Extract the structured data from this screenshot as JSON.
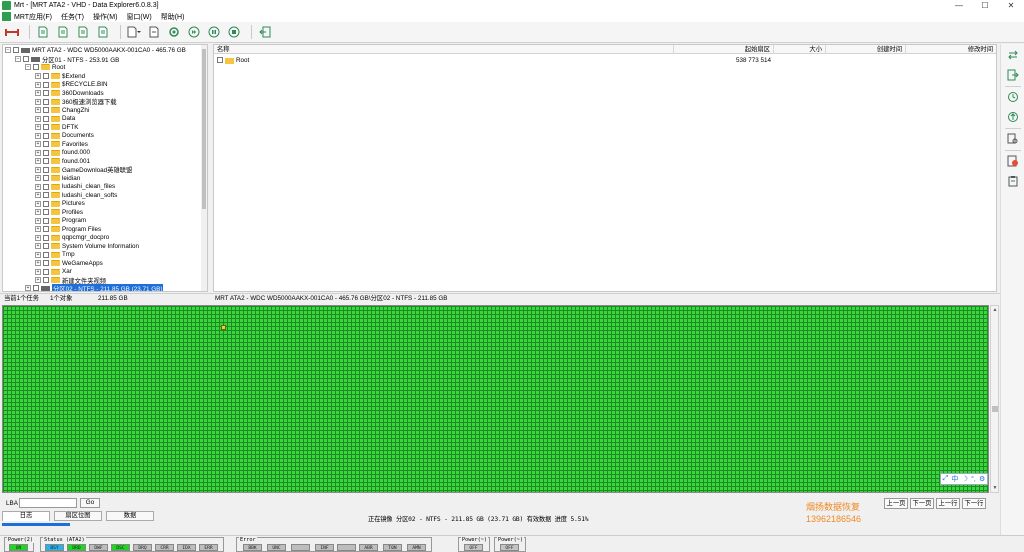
{
  "window": {
    "title": "Mrt - [MRT ATA2 - VHD - Data Explorer6.0.8.3]",
    "minimize": "—",
    "maximize": "☐",
    "close": "✕"
  },
  "menu": {
    "items": [
      "MRT应用(F)",
      "任务(T)",
      "操作(M)",
      "窗口(W)",
      "帮助(H)"
    ]
  },
  "tree": {
    "disk": "MRT ATA2 - WDC WD5000AAKX-001CA0 - 465.76 GB",
    "partition1": "分区01 - NTFS - 253.91 GB",
    "root": "Root",
    "folders": [
      "$Extend",
      "$RECYCLE.BIN",
      "360Downloads",
      "360极速浏览器下载",
      "ChangZhi",
      "Data",
      "DFTK",
      "Documents",
      "Favorites",
      "found.000",
      "found.001",
      "GameDownload英雄联盟",
      "leidian",
      "ludashi_clean_files",
      "ludashi_clean_softs",
      "Pictures",
      "Profiles",
      "Program",
      "Program Files",
      "qqpcmgr_docpro",
      "System Volume Information",
      "Tmp",
      "WeGameApps",
      "Xar",
      "新建文件夹视频"
    ],
    "partition2": "分区02 - NTFS - 211.85 GB (23.71 GB)"
  },
  "filelist": {
    "columns": [
      "名称",
      "起始扇区",
      "大小",
      "创建时间",
      "修改时间"
    ],
    "rows": [
      {
        "name": "Root",
        "start_sector": "538 773 514",
        "size": "",
        "created": "",
        "modified": ""
      }
    ]
  },
  "status": {
    "tasks": "当前1个任务",
    "objects": "1个对象",
    "size": "211.85 GB",
    "path": "MRT ATA2 - WDC WD5000AAKX-001CA0 - 465.76 GB\\分区02 - NTFS - 211.85 GB"
  },
  "ime": {
    "items": [
      "中",
      "☽",
      "°,",
      "⚙"
    ]
  },
  "bottom": {
    "lba_label": "LBA",
    "lba_value": "",
    "go_label": "Go",
    "tabs": [
      "日志",
      "扇区位图",
      "数据"
    ],
    "task_text": "正在镜像 分区02 - NTFS - 211.85 GB (23.71 GB) 有效数据 进度 5.51%",
    "watermark_line1": "烟扬数据恢复",
    "watermark_line2": "13962186546",
    "nav": [
      "上一页",
      "下一页",
      "上一行",
      "下一行"
    ]
  },
  "leds": {
    "power2": {
      "title": "Power(2)",
      "items": [
        "ON"
      ]
    },
    "status": {
      "title": "Status (ATA2)",
      "items": [
        "BSY",
        "DRD",
        "DWF",
        "DSC",
        "DRQ",
        "CRR",
        "IDX",
        "ERR"
      ]
    },
    "error": {
      "title": "Error",
      "items": [
        "BBK",
        "UNC",
        "",
        "INF",
        "",
        "ABR",
        "T0N",
        "AMN"
      ]
    },
    "power_a": {
      "title": "Power(~)",
      "items": [
        "OFF"
      ]
    },
    "power_b": {
      "title": "Power(~)",
      "items": [
        "OFF"
      ]
    }
  },
  "colors": {
    "map_fill": "#39d63e",
    "map_grid": "#1d8a22",
    "accent": "#1e6fd9",
    "watermark": "#f08a24"
  }
}
